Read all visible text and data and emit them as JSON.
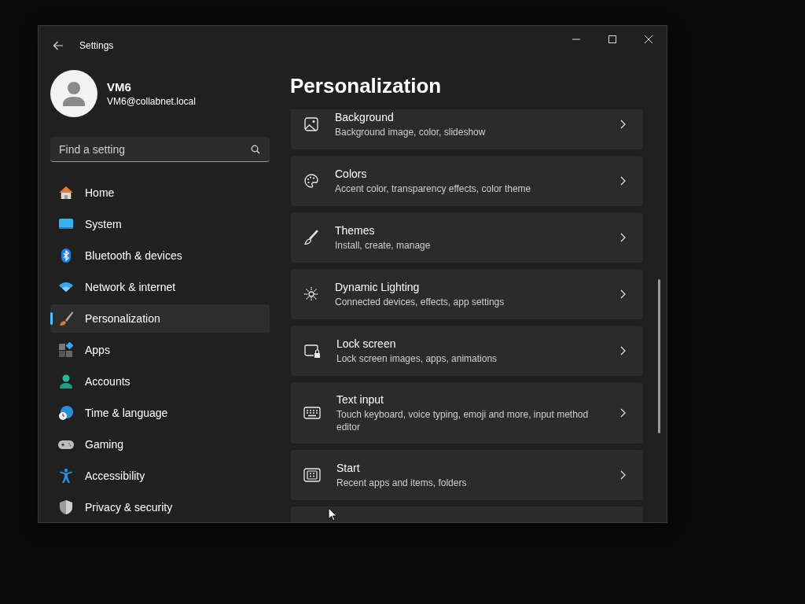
{
  "window": {
    "title": "Settings"
  },
  "profile": {
    "name": "VM6",
    "email": "VM6@collabnet.local"
  },
  "search": {
    "placeholder": "Find a setting"
  },
  "nav": [
    {
      "label": "Home",
      "selected": false
    },
    {
      "label": "System",
      "selected": false
    },
    {
      "label": "Bluetooth & devices",
      "selected": false
    },
    {
      "label": "Network & internet",
      "selected": false
    },
    {
      "label": "Personalization",
      "selected": true
    },
    {
      "label": "Apps",
      "selected": false
    },
    {
      "label": "Accounts",
      "selected": false
    },
    {
      "label": "Time & language",
      "selected": false
    },
    {
      "label": "Gaming",
      "selected": false
    },
    {
      "label": "Accessibility",
      "selected": false
    },
    {
      "label": "Privacy & security",
      "selected": false
    }
  ],
  "page": {
    "title": "Personalization"
  },
  "cards": [
    {
      "kind": "setting",
      "title": "Background",
      "subtitle": "Background image, color, slideshow"
    },
    {
      "kind": "setting",
      "title": "Colors",
      "subtitle": "Accent color, transparency effects, color theme"
    },
    {
      "kind": "setting",
      "title": "Themes",
      "subtitle": "Install, create, manage"
    },
    {
      "kind": "setting",
      "title": "Dynamic Lighting",
      "subtitle": "Connected devices, effects, app settings"
    },
    {
      "kind": "setting",
      "title": "Lock screen",
      "subtitle": "Lock screen images, apps, animations"
    },
    {
      "kind": "setting",
      "title": "Text input",
      "subtitle": "Touch keyboard, voice typing, emoji and more, input method editor"
    },
    {
      "kind": "setting",
      "title": "Start",
      "subtitle": "Recent apps and items, folders"
    },
    {
      "kind": "clipped"
    }
  ]
}
